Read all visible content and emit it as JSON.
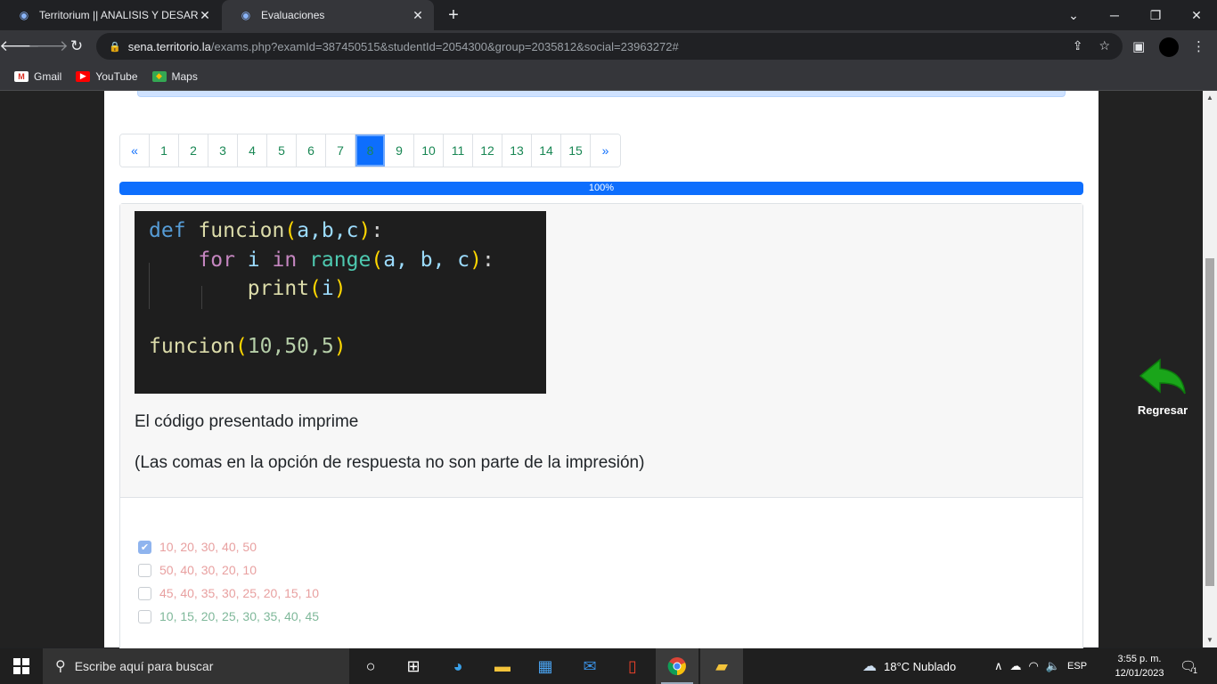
{
  "browser": {
    "tabs": [
      {
        "title": "Territorium || ANALISIS Y DESARR",
        "active": false
      },
      {
        "title": "Evaluaciones",
        "active": true
      }
    ],
    "url_host": "sena.territorio.la",
    "url_path": "/exams.php?examId=387450515&studentId=2054300&group=2035812&social=23963272#",
    "bookmarks": [
      "Gmail",
      "YouTube",
      "Maps"
    ]
  },
  "exam": {
    "pages": [
      "«",
      "1",
      "2",
      "3",
      "4",
      "5",
      "6",
      "7",
      "8",
      "9",
      "10",
      "11",
      "12",
      "13",
      "14",
      "15",
      "»"
    ],
    "active_page": "8",
    "progress_label": "100%",
    "progress_fraction": 1.0,
    "code": {
      "l1_def": "def",
      "l1_fn": "funcion",
      "l1_args": "a,b,c",
      "l2_for": "for",
      "l2_var": "i",
      "l2_in": "in",
      "l2_range": "range",
      "l2_args": "a, b, c",
      "l3_print": "print",
      "l3_arg": "i",
      "l5_fn": "funcion",
      "l5_args": "10,50,5"
    },
    "question_1": "El código presentado imprime",
    "question_2": "(Las comas en la opción de respuesta no son parte de la impresión)",
    "options": [
      {
        "label": "10, 20, 30, 40, 50",
        "checked": true,
        "state": "wrong"
      },
      {
        "label": "50, 40, 30, 20, 10",
        "checked": false,
        "state": "wrong"
      },
      {
        "label": "45, 40, 35, 30, 25, 20, 15, 10",
        "checked": false,
        "state": "wrong"
      },
      {
        "label": "10, 15, 20, 25, 30, 35, 40, 45",
        "checked": false,
        "state": "right"
      }
    ],
    "back_label": "Regresar"
  },
  "taskbar": {
    "search_placeholder": "Escribe aquí para buscar",
    "weather": "18°C  Nublado",
    "lang": "ESP",
    "time": "3:55 p. m.",
    "date": "12/01/2023",
    "notifications": "1"
  },
  "colors": {
    "primary": "#0d6efd",
    "wrong_option": "#e8a0a0",
    "right_option": "#7fb89a",
    "back_arrow": "#1aa51a"
  }
}
